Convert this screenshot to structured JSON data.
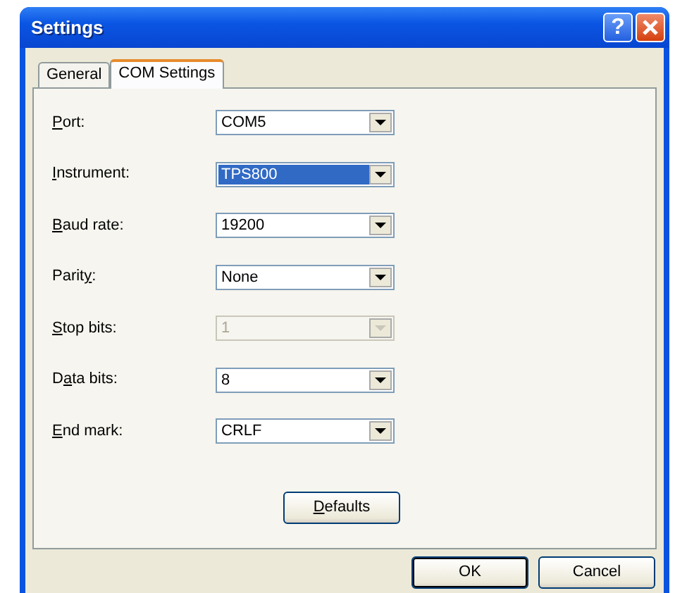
{
  "window": {
    "title": "Settings",
    "buttons": [
      {
        "kind": "help",
        "label": "?"
      },
      {
        "kind": "close"
      }
    ]
  },
  "tabs": [
    {
      "label": "General",
      "selected": false
    },
    {
      "label": "COM Settings",
      "selected": true
    }
  ],
  "fields": [
    {
      "access_key": "P",
      "label_end": "ort:",
      "value": "COM5",
      "highlighted": false,
      "disabled": false
    },
    {
      "access_key": "I",
      "label_end": "nstrument:",
      "value": "TPS800",
      "highlighted": true,
      "disabled": false
    },
    {
      "access_key": "B",
      "label_end": "aud rate:",
      "value": "19200",
      "highlighted": false,
      "disabled": false
    },
    {
      "label_start": "Parit",
      "access_key": "y",
      "label_end": ":",
      "value": "None",
      "highlighted": false,
      "disabled": false
    },
    {
      "access_key": "S",
      "label_end": "top bits:",
      "value": "1",
      "highlighted": false,
      "disabled": true
    },
    {
      "label_start": "D",
      "access_key": "a",
      "label_end": "ta bits:",
      "value": "8",
      "highlighted": false,
      "disabled": false
    },
    {
      "access_key": "E",
      "label_end": "nd mark:",
      "value": "CRLF",
      "highlighted": false,
      "disabled": false
    }
  ],
  "defaults_button": {
    "access_key": "D",
    "label_end": "efaults"
  },
  "footer_buttons": [
    {
      "label": "OK",
      "default": true
    },
    {
      "label": "Cancel",
      "default": false
    }
  ]
}
